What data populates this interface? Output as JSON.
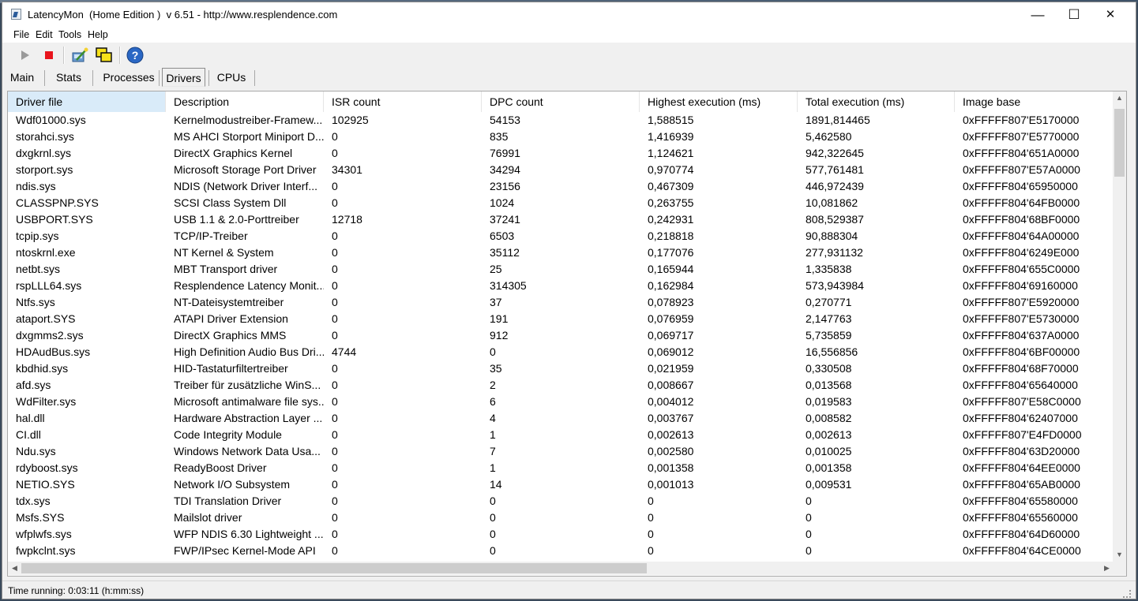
{
  "window": {
    "title": "LatencyMon  (Home Edition )  v 6.51 - http://www.resplendence.com",
    "minimize": "—",
    "maximize": "☐",
    "close": "✕"
  },
  "menu": [
    "File",
    "Edit",
    "Tools",
    "Help"
  ],
  "toolbar": [
    {
      "name": "start-icon",
      "tooltip": "Start"
    },
    {
      "name": "stop-icon",
      "tooltip": "Stop"
    },
    {
      "name": "process-wizard-icon",
      "tooltip": "Process"
    },
    {
      "name": "windows-icon",
      "tooltip": "Windows"
    },
    {
      "name": "help-icon",
      "tooltip": "Help"
    }
  ],
  "tabs": [
    "Main",
    "Stats",
    "Processes",
    "Drivers",
    "CPUs"
  ],
  "active_tab": "Drivers",
  "columns": [
    "Driver file",
    "Description",
    "ISR count",
    "DPC count",
    "Highest execution (ms)",
    "Total execution (ms)",
    "Image base"
  ],
  "sorted_column": "Driver file",
  "rows": [
    [
      "Wdf01000.sys",
      "Kernelmodustreiber-Framew...",
      "102925",
      "54153",
      "1,588515",
      "1891,814465",
      "0xFFFFF807'E5170000"
    ],
    [
      "storahci.sys",
      "MS AHCI Storport Miniport D...",
      "0",
      "835",
      "1,416939",
      "5,462580",
      "0xFFFFF807'E5770000"
    ],
    [
      "dxgkrnl.sys",
      "DirectX Graphics Kernel",
      "0",
      "76991",
      "1,124621",
      "942,322645",
      "0xFFFFF804'651A0000"
    ],
    [
      "storport.sys",
      "Microsoft Storage Port Driver",
      "34301",
      "34294",
      "0,970774",
      "577,761481",
      "0xFFFFF807'E57A0000"
    ],
    [
      "ndis.sys",
      "NDIS (Network Driver Interf...",
      "0",
      "23156",
      "0,467309",
      "446,972439",
      "0xFFFFF804'65950000"
    ],
    [
      "CLASSPNP.SYS",
      "SCSI Class System Dll",
      "0",
      "1024",
      "0,263755",
      "10,081862",
      "0xFFFFF804'64FB0000"
    ],
    [
      "USBPORT.SYS",
      "USB 1.1 & 2.0-Porttreiber",
      "12718",
      "37241",
      "0,242931",
      "808,529387",
      "0xFFFFF804'68BF0000"
    ],
    [
      "tcpip.sys",
      "TCP/IP-Treiber",
      "0",
      "6503",
      "0,218818",
      "90,888304",
      "0xFFFFF804'64A00000"
    ],
    [
      "ntoskrnl.exe",
      "NT Kernel & System",
      "0",
      "35112",
      "0,177076",
      "277,931132",
      "0xFFFFF804'6249E000"
    ],
    [
      "netbt.sys",
      "MBT Transport driver",
      "0",
      "25",
      "0,165944",
      "1,335838",
      "0xFFFFF804'655C0000"
    ],
    [
      "rspLLL64.sys",
      "Resplendence Latency Monit...",
      "0",
      "314305",
      "0,162984",
      "573,943984",
      "0xFFFFF804'69160000"
    ],
    [
      "Ntfs.sys",
      "NT-Dateisystemtreiber",
      "0",
      "37",
      "0,078923",
      "0,270771",
      "0xFFFFF807'E5920000"
    ],
    [
      "ataport.SYS",
      "ATAPI Driver Extension",
      "0",
      "191",
      "0,076959",
      "2,147763",
      "0xFFFFF807'E5730000"
    ],
    [
      "dxgmms2.sys",
      "DirectX Graphics MMS",
      "0",
      "912",
      "0,069717",
      "5,735859",
      "0xFFFFF804'637A0000"
    ],
    [
      "HDAudBus.sys",
      "High Definition Audio Bus Dri...",
      "4744",
      "0",
      "0,069012",
      "16,556856",
      "0xFFFFF804'6BF00000"
    ],
    [
      "kbdhid.sys",
      "HID-Tastaturfiltertreiber",
      "0",
      "35",
      "0,021959",
      "0,330508",
      "0xFFFFF804'68F70000"
    ],
    [
      "afd.sys",
      "Treiber für zusätzliche WinS...",
      "0",
      "2",
      "0,008667",
      "0,013568",
      "0xFFFFF804'65640000"
    ],
    [
      "WdFilter.sys",
      "Microsoft antimalware file sys...",
      "0",
      "6",
      "0,004012",
      "0,019583",
      "0xFFFFF807'E58C0000"
    ],
    [
      "hal.dll",
      "Hardware Abstraction Layer ...",
      "0",
      "4",
      "0,003767",
      "0,008582",
      "0xFFFFF804'62407000"
    ],
    [
      "CI.dll",
      "Code Integrity Module",
      "0",
      "1",
      "0,002613",
      "0,002613",
      "0xFFFFF807'E4FD0000"
    ],
    [
      "Ndu.sys",
      "Windows Network Data Usa...",
      "0",
      "7",
      "0,002580",
      "0,010025",
      "0xFFFFF804'63D20000"
    ],
    [
      "rdyboost.sys",
      "ReadyBoost Driver",
      "0",
      "1",
      "0,001358",
      "0,001358",
      "0xFFFFF804'64EE0000"
    ],
    [
      "NETIO.SYS",
      "Network I/O Subsystem",
      "0",
      "14",
      "0,001013",
      "0,009531",
      "0xFFFFF804'65AB0000"
    ],
    [
      "tdx.sys",
      "TDI Translation Driver",
      "0",
      "0",
      "0",
      "0",
      "0xFFFFF804'65580000"
    ],
    [
      "Msfs.SYS",
      "Mailslot driver",
      "0",
      "0",
      "0",
      "0",
      "0xFFFFF804'65560000"
    ],
    [
      "wfplwfs.sys",
      "WFP NDIS 6.30 Lightweight ...",
      "0",
      "0",
      "0",
      "0",
      "0xFFFFF804'64D60000"
    ],
    [
      "fwpkclnt.sys",
      "FWP/IPsec Kernel-Mode API",
      "0",
      "0",
      "0",
      "0",
      "0xFFFFF804'64CE0000"
    ]
  ],
  "status": "Time running: 0:03:11  (h:mm:ss)"
}
